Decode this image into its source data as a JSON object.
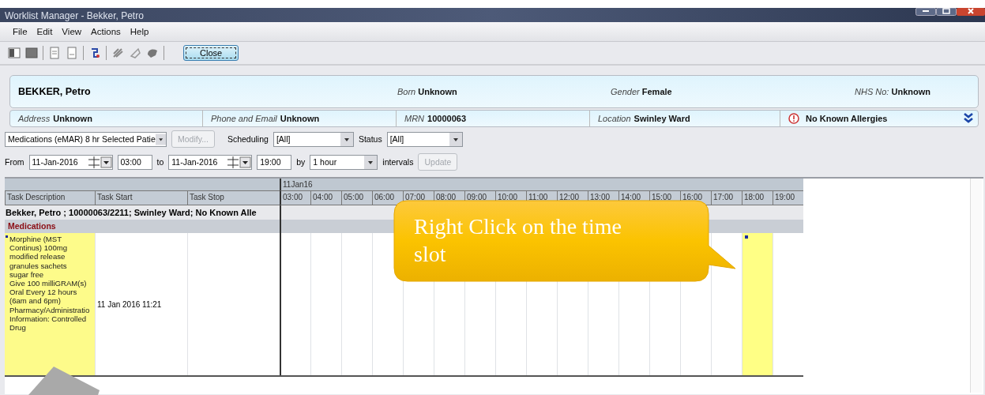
{
  "window": {
    "title": "Worklist Manager - Bekker, Petro"
  },
  "menu": [
    {
      "label": "File"
    },
    {
      "label": "Edit"
    },
    {
      "label": "View"
    },
    {
      "label": "Actions"
    },
    {
      "label": "Help"
    }
  ],
  "toolbar": {
    "close_button": "Close"
  },
  "banner": {
    "name": "BEKKER, Petro",
    "fields": [
      {
        "label": "Born",
        "value": "Unknown"
      },
      {
        "label": "Gender",
        "value": "Female"
      },
      {
        "label": "NHS No:",
        "value": "Unknown"
      }
    ],
    "details": [
      {
        "label": "Address",
        "value": "Unknown"
      },
      {
        "label": "Phone and Email",
        "value": "Unknown"
      },
      {
        "label": "MRN",
        "value": "10000063"
      },
      {
        "label": "Location",
        "value": "Swinley Ward"
      }
    ],
    "allergies": "No Known Allergies"
  },
  "filters": {
    "worklist": "Medications (eMAR) 8 hr Selected Patie",
    "modify": {
      "label": "Modify...",
      "disabled": true
    },
    "scheduling_label": "Scheduling",
    "scheduling": "[All]",
    "status_label": "Status",
    "status": "[All]"
  },
  "range": {
    "from_label": "From",
    "from_date": "11-Jan-2016",
    "from_time": "03:00",
    "to_label": "to",
    "to_date": "11-Jan-2016",
    "to_time": "19:00",
    "by_label": "by",
    "interval": "1 hour",
    "intervals_label": "intervals",
    "update": {
      "label": "Update",
      "disabled": true
    }
  },
  "grid": {
    "date": "11Jan16",
    "columns": [
      "Task Description",
      "Task Start",
      "Task Stop"
    ],
    "hours": [
      {
        "label": "03:00",
        "selected": false
      },
      {
        "label": "04:00",
        "selected": false
      },
      {
        "label": "05:00",
        "selected": false
      },
      {
        "label": "06:00",
        "selected": false
      },
      {
        "label": "07:00",
        "selected": false
      },
      {
        "label": "08:00",
        "selected": false
      },
      {
        "label": "09:00",
        "selected": false
      },
      {
        "label": "10:00",
        "selected": false
      },
      {
        "label": "11:00",
        "selected": false
      },
      {
        "label": "12:00",
        "selected": false
      },
      {
        "label": "13:00",
        "selected": false
      },
      {
        "label": "14:00",
        "selected": false
      },
      {
        "label": "15:00",
        "selected": false
      },
      {
        "label": "16:00",
        "selected": false
      },
      {
        "label": "17:00",
        "selected": false
      },
      {
        "label": "18:00",
        "selected": true
      },
      {
        "label": "19:00",
        "selected": false
      }
    ],
    "patient_row": "Bekker, Petro ; 10000063/2211; Swinley Ward; No Known Alle",
    "section": "Medications",
    "tasks": [
      {
        "description_lines": [
          "Morphine (MST",
          "Continus) 100mg",
          "modified release",
          "granules sachets",
          "sugar free",
          "Give 100 milliGRAM(s)",
          "Oral Every 12 hours",
          "(6am and 6pm)",
          "Pharmacy/Administratio",
          "Information: Controlled",
          "Drug"
        ],
        "start": "11 Jan 2016 11:21",
        "flagged": true
      }
    ]
  },
  "callout": {
    "text": "Right Click on the time slot"
  }
}
